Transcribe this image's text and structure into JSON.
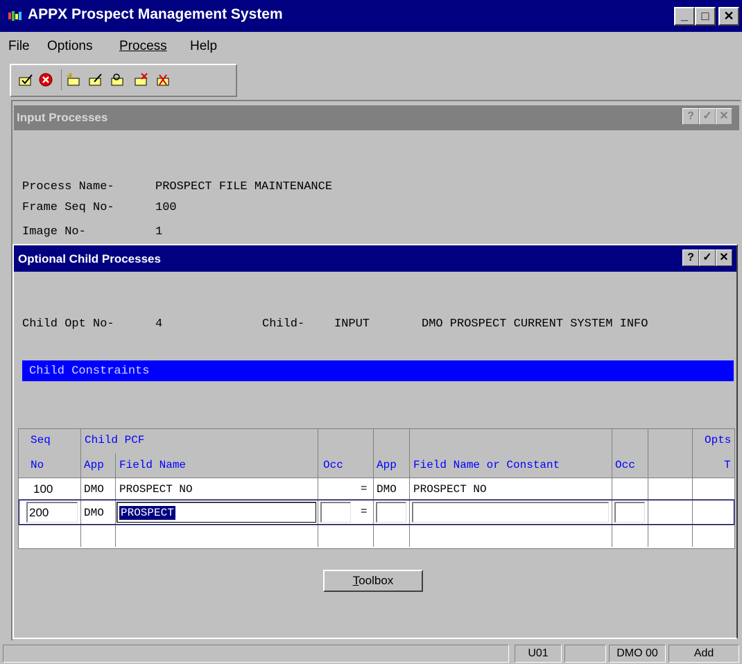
{
  "window": {
    "title": "APPX Prospect Management System",
    "minimize": "_",
    "maximize": "□",
    "close": "✕"
  },
  "menu": {
    "items": [
      "File",
      "Options",
      "Process",
      "Help"
    ]
  },
  "toolbar": {
    "icons": [
      "ok-folder-icon",
      "cancel-icon",
      "new-folder-icon",
      "edit-folder-icon",
      "search-folder-icon",
      "delete-folder-icon",
      "purge-folder-icon"
    ]
  },
  "input_processes": {
    "title": "Input Processes",
    "help": "?",
    "ok": "✓",
    "close": "✕",
    "process_name_label": "Process Name-",
    "process_name": "PROSPECT FILE MAINTENANCE",
    "frame_seq_label": "Frame Seq No-",
    "frame_seq": "100",
    "image_no_label": "Image No-",
    "image_no": "1"
  },
  "child_processes": {
    "title": "Optional Child Processes",
    "help": "?",
    "ok": "✓",
    "close": "✕",
    "child_opt_label": "Child Opt No-",
    "child_opt": "4",
    "child_label": "Child-",
    "child_type": "INPUT",
    "child_desc": "DMO PROSPECT CURRENT SYSTEM INFO",
    "constraints_label": "Child Constraints"
  },
  "table": {
    "headers": {
      "seq": "Seq",
      "no": "No",
      "child_pcf": "Child PCF",
      "app": "App",
      "field_name": "Field Name",
      "occ": "Occ",
      "app2": "App",
      "field_name_const": "Field Name or Constant",
      "occ2": "Occ",
      "opts": "Opts",
      "t": "T"
    },
    "rows": [
      {
        "seq": "100",
        "app": "DMO",
        "field": "PROSPECT NO",
        "occ": "",
        "op": "=",
        "app2": "DMO",
        "field2": "PROSPECT NO"
      },
      {
        "seq": "200",
        "app": "DMO",
        "field": "PROSPECT",
        "occ": "",
        "op": "=",
        "app2": "",
        "field2": ""
      }
    ]
  },
  "buttons": {
    "toolbox_prefix": "T",
    "toolbox_rest": "oolbox"
  },
  "status": {
    "user": "U01",
    "app": "DMO 00",
    "mode": "Add"
  }
}
